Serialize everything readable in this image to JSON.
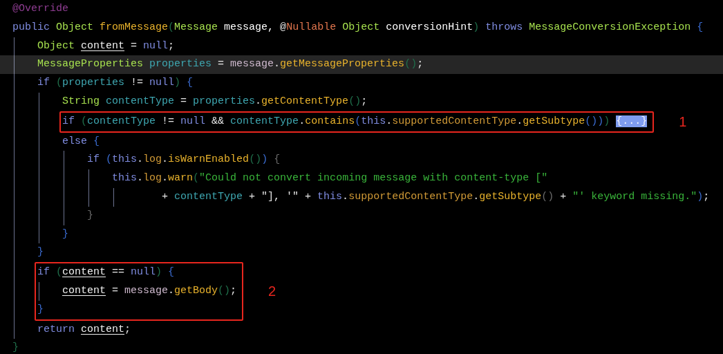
{
  "editor": {
    "blocks": [
      {
        "kind": "line",
        "highlighted": false,
        "tokens": [
          {
            "text": "@Override",
            "kind": "annotation"
          }
        ]
      },
      {
        "kind": "line",
        "highlighted": false,
        "tokens": [
          {
            "text": "public ",
            "kind": "keyword"
          },
          {
            "text": "Object ",
            "kind": "type"
          },
          {
            "text": "fromMessage",
            "kind": "method"
          },
          {
            "text": "(",
            "kind": "paren"
          },
          {
            "text": "Message ",
            "kind": "type"
          },
          {
            "text": "message, ",
            "kind": "param"
          },
          {
            "text": "@",
            "kind": "plain"
          },
          {
            "text": "Nullable ",
            "kind": "annotationref"
          },
          {
            "text": "Object ",
            "kind": "type"
          },
          {
            "text": "conversionHint",
            "kind": "param"
          },
          {
            "text": ") ",
            "kind": "paren"
          },
          {
            "text": "throws ",
            "kind": "keyword"
          },
          {
            "text": "MessageConversionException ",
            "kind": "type"
          },
          {
            "text": "{",
            "kind": "brace"
          }
        ]
      },
      {
        "kind": "block",
        "children": [
          {
            "kind": "line",
            "highlighted": false,
            "tokens": [
              {
                "text": "Object ",
                "kind": "type"
              },
              {
                "text": "content",
                "kind": "reassigned"
              },
              {
                "text": " = ",
                "kind": "plain"
              },
              {
                "text": "null",
                "kind": "keyword"
              },
              {
                "text": ";",
                "kind": "plain"
              }
            ]
          },
          {
            "kind": "line",
            "highlighted": true,
            "tokens": [
              {
                "text": "MessageProperties ",
                "kind": "type"
              },
              {
                "text": "properties",
                "kind": "local"
              },
              {
                "text": " = ",
                "kind": "plain"
              },
              {
                "text": "message",
                "kind": "paramuse"
              },
              {
                "text": ".",
                "kind": "plain"
              },
              {
                "text": "getMessageProperties",
                "kind": "method"
              },
              {
                "text": "()",
                "kind": "paren"
              },
              {
                "text": ";",
                "kind": "plain"
              }
            ]
          },
          {
            "kind": "line",
            "highlighted": false,
            "tokens": [
              {
                "text": "if ",
                "kind": "keyword"
              },
              {
                "text": "(",
                "kind": "paren"
              },
              {
                "text": "properties",
                "kind": "local"
              },
              {
                "text": " != ",
                "kind": "plain"
              },
              {
                "text": "null",
                "kind": "keyword"
              },
              {
                "text": ") ",
                "kind": "paren"
              },
              {
                "text": "{",
                "kind": "brace"
              }
            ]
          },
          {
            "kind": "block",
            "children": [
              {
                "kind": "line",
                "highlighted": false,
                "tokens": [
                  {
                    "text": "String ",
                    "kind": "type"
                  },
                  {
                    "text": "contentType",
                    "kind": "local"
                  },
                  {
                    "text": " = ",
                    "kind": "plain"
                  },
                  {
                    "text": "properties",
                    "kind": "local"
                  },
                  {
                    "text": ".",
                    "kind": "plain"
                  },
                  {
                    "text": "getContentType",
                    "kind": "method"
                  },
                  {
                    "text": "()",
                    "kind": "paren"
                  },
                  {
                    "text": ";",
                    "kind": "plain"
                  }
                ]
              },
              {
                "kind": "callout",
                "label": "1",
                "children": [
                  {
                    "kind": "line",
                    "highlighted": false,
                    "tokens": [
                      {
                        "text": "if ",
                        "kind": "keyword"
                      },
                      {
                        "text": "(",
                        "kind": "paren"
                      },
                      {
                        "text": "contentType",
                        "kind": "local"
                      },
                      {
                        "text": " != ",
                        "kind": "plain"
                      },
                      {
                        "text": "null",
                        "kind": "keyword"
                      },
                      {
                        "text": " && ",
                        "kind": "plain"
                      },
                      {
                        "text": "contentType",
                        "kind": "local"
                      },
                      {
                        "text": ".",
                        "kind": "plain"
                      },
                      {
                        "text": "contains",
                        "kind": "method"
                      },
                      {
                        "text": "(",
                        "kind": "brace"
                      },
                      {
                        "text": "this",
                        "kind": "keyword"
                      },
                      {
                        "text": ".",
                        "kind": "plain"
                      },
                      {
                        "text": "supportedContentType",
                        "kind": "field"
                      },
                      {
                        "text": ".",
                        "kind": "plain"
                      },
                      {
                        "text": "getSubtype",
                        "kind": "method"
                      },
                      {
                        "text": "()",
                        "kind": "brace"
                      },
                      {
                        "text": ")",
                        "kind": "brace"
                      },
                      {
                        "text": ") ",
                        "kind": "paren"
                      },
                      {
                        "text": "{...}",
                        "kind": "fold"
                      }
                    ]
                  }
                ]
              },
              {
                "kind": "line",
                "highlighted": false,
                "tokens": [
                  {
                    "text": "else ",
                    "kind": "keyword"
                  },
                  {
                    "text": "{",
                    "kind": "brace"
                  }
                ]
              },
              {
                "kind": "block",
                "children": [
                  {
                    "kind": "line",
                    "highlighted": false,
                    "tokens": [
                      {
                        "text": "if ",
                        "kind": "keyword"
                      },
                      {
                        "text": "(",
                        "kind": "brace"
                      },
                      {
                        "text": "this",
                        "kind": "keyword"
                      },
                      {
                        "text": ".",
                        "kind": "plain"
                      },
                      {
                        "text": "log",
                        "kind": "field"
                      },
                      {
                        "text": ".",
                        "kind": "plain"
                      },
                      {
                        "text": "isWarnEnabled",
                        "kind": "method"
                      },
                      {
                        "text": "()",
                        "kind": "paren"
                      },
                      {
                        "text": ") ",
                        "kind": "brace"
                      },
                      {
                        "text": "{",
                        "kind": "dimbrace"
                      }
                    ]
                  },
                  {
                    "kind": "block",
                    "children": [
                      {
                        "kind": "line",
                        "highlighted": false,
                        "tokens": [
                          {
                            "text": "this",
                            "kind": "keyword"
                          },
                          {
                            "text": ".",
                            "kind": "plain"
                          },
                          {
                            "text": "log",
                            "kind": "field"
                          },
                          {
                            "text": ".",
                            "kind": "plain"
                          },
                          {
                            "text": "warn",
                            "kind": "method"
                          },
                          {
                            "text": "(",
                            "kind": "paren"
                          },
                          {
                            "text": "\"Could not convert incoming message with content-type [\"",
                            "kind": "string"
                          }
                        ]
                      },
                      {
                        "kind": "block",
                        "children": [
                          {
                            "kind": "line",
                            "highlighted": false,
                            "tokens": [
                              {
                                "text": "    + ",
                                "kind": "plain"
                              },
                              {
                                "text": "contentType",
                                "kind": "local"
                              },
                              {
                                "text": " + ",
                                "kind": "plain"
                              },
                              {
                                "text": "\"], '\"",
                                "kind": "plain"
                              },
                              {
                                "text": " + ",
                                "kind": "plain"
                              },
                              {
                                "text": "this",
                                "kind": "keyword"
                              },
                              {
                                "text": ".",
                                "kind": "plain"
                              },
                              {
                                "text": "supportedContentType",
                                "kind": "field"
                              },
                              {
                                "text": ".",
                                "kind": "plain"
                              },
                              {
                                "text": "getSubtype",
                                "kind": "method"
                              },
                              {
                                "text": "()",
                                "kind": "dimbrace"
                              },
                              {
                                "text": " + ",
                                "kind": "plain"
                              },
                              {
                                "text": "\"' keyword missing.\"",
                                "kind": "string"
                              },
                              {
                                "text": ")",
                                "kind": "brace"
                              },
                              {
                                "text": ";",
                                "kind": "plain"
                              }
                            ]
                          }
                        ]
                      }
                    ]
                  },
                  {
                    "kind": "line",
                    "highlighted": false,
                    "tokens": [
                      {
                        "text": "}",
                        "kind": "dimbrace"
                      }
                    ]
                  }
                ]
              },
              {
                "kind": "line",
                "highlighted": false,
                "tokens": [
                  {
                    "text": "}",
                    "kind": "brace"
                  }
                ]
              }
            ]
          },
          {
            "kind": "line",
            "highlighted": false,
            "tokens": [
              {
                "text": "}",
                "kind": "brace"
              }
            ]
          },
          {
            "kind": "callout",
            "label": "2",
            "children": [
              {
                "kind": "line",
                "highlighted": false,
                "tokens": [
                  {
                    "text": "if ",
                    "kind": "keyword"
                  },
                  {
                    "text": "(",
                    "kind": "paren"
                  },
                  {
                    "text": "content",
                    "kind": "reassigned"
                  },
                  {
                    "text": " == ",
                    "kind": "plain"
                  },
                  {
                    "text": "null",
                    "kind": "keyword"
                  },
                  {
                    "text": ") ",
                    "kind": "paren"
                  },
                  {
                    "text": "{",
                    "kind": "brace"
                  }
                ]
              },
              {
                "kind": "block",
                "children": [
                  {
                    "kind": "line",
                    "highlighted": false,
                    "tokens": [
                      {
                        "text": "content",
                        "kind": "reassigned"
                      },
                      {
                        "text": " = ",
                        "kind": "plain"
                      },
                      {
                        "text": "message",
                        "kind": "paramuse"
                      },
                      {
                        "text": ".",
                        "kind": "plain"
                      },
                      {
                        "text": "getBody",
                        "kind": "method"
                      },
                      {
                        "text": "()",
                        "kind": "paren"
                      },
                      {
                        "text": ";",
                        "kind": "plain"
                      }
                    ]
                  }
                ]
              },
              {
                "kind": "line",
                "highlighted": false,
                "tokens": [
                  {
                    "text": "}",
                    "kind": "brace"
                  }
                ]
              }
            ]
          },
          {
            "kind": "line",
            "highlighted": false,
            "tokens": [
              {
                "text": "return ",
                "kind": "keyword"
              },
              {
                "text": "content",
                "kind": "reassigned"
              },
              {
                "text": ";",
                "kind": "plain"
              }
            ]
          }
        ]
      },
      {
        "kind": "line",
        "highlighted": false,
        "tokens": [
          {
            "text": "}",
            "kind": "paren"
          }
        ]
      }
    ]
  }
}
